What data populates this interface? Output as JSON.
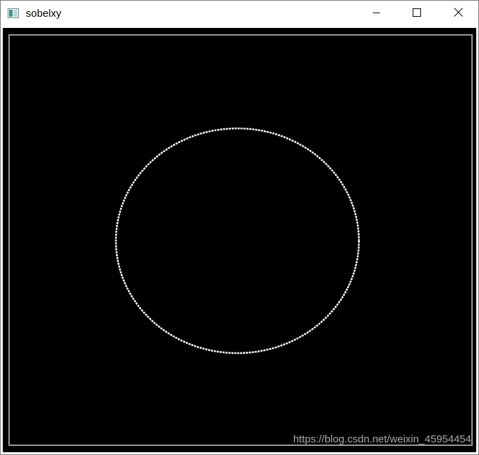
{
  "window": {
    "title": "sobelxy",
    "icon": "app-window-icon",
    "controls": {
      "minimize_icon": "minimize-icon",
      "maximize_icon": "maximize-icon",
      "close_icon": "close-icon"
    }
  },
  "image": {
    "background_color": "#000000",
    "edge_color": "#ffffff",
    "content": [
      "rectangular-border-edge",
      "circle-edge"
    ]
  },
  "watermark": {
    "text": "https://blog.csdn.net/weixin_45954454"
  }
}
